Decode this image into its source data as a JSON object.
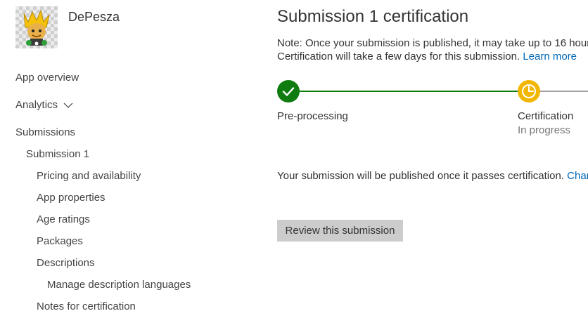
{
  "app": {
    "name": "DePesza"
  },
  "sidebar": {
    "items": [
      {
        "label": "App overview"
      },
      {
        "label": "Analytics"
      },
      {
        "label": "Submissions"
      },
      {
        "label": "Submission 1"
      },
      {
        "label": "Pricing and availability"
      },
      {
        "label": "App properties"
      },
      {
        "label": "Age ratings"
      },
      {
        "label": "Packages"
      },
      {
        "label": "Descriptions"
      },
      {
        "label": "Manage description languages"
      },
      {
        "label": "Notes for certification"
      }
    ]
  },
  "main": {
    "title": "Submission 1 certification",
    "note_line1": "Note: Once your submission is published, it may take up to 16 hour",
    "note_line2": "Certification will take a few days for this submission.",
    "learn_more": "Learn more",
    "steps": [
      {
        "label": "Pre-processing",
        "status": "",
        "state": "complete",
        "icon": "check-icon"
      },
      {
        "label": "Certification",
        "status": "In progress",
        "state": "in-progress",
        "icon": "clock-icon"
      }
    ],
    "status_text": "Your submission will be published once it passes certification.",
    "status_link": "Chan",
    "review_button": "Review this submission"
  },
  "colors": {
    "complete": "#107c10",
    "in_progress": "#f2b705",
    "pending_line": "#a0a0a0",
    "link": "#0067b8",
    "button_bg": "#cccccc"
  }
}
